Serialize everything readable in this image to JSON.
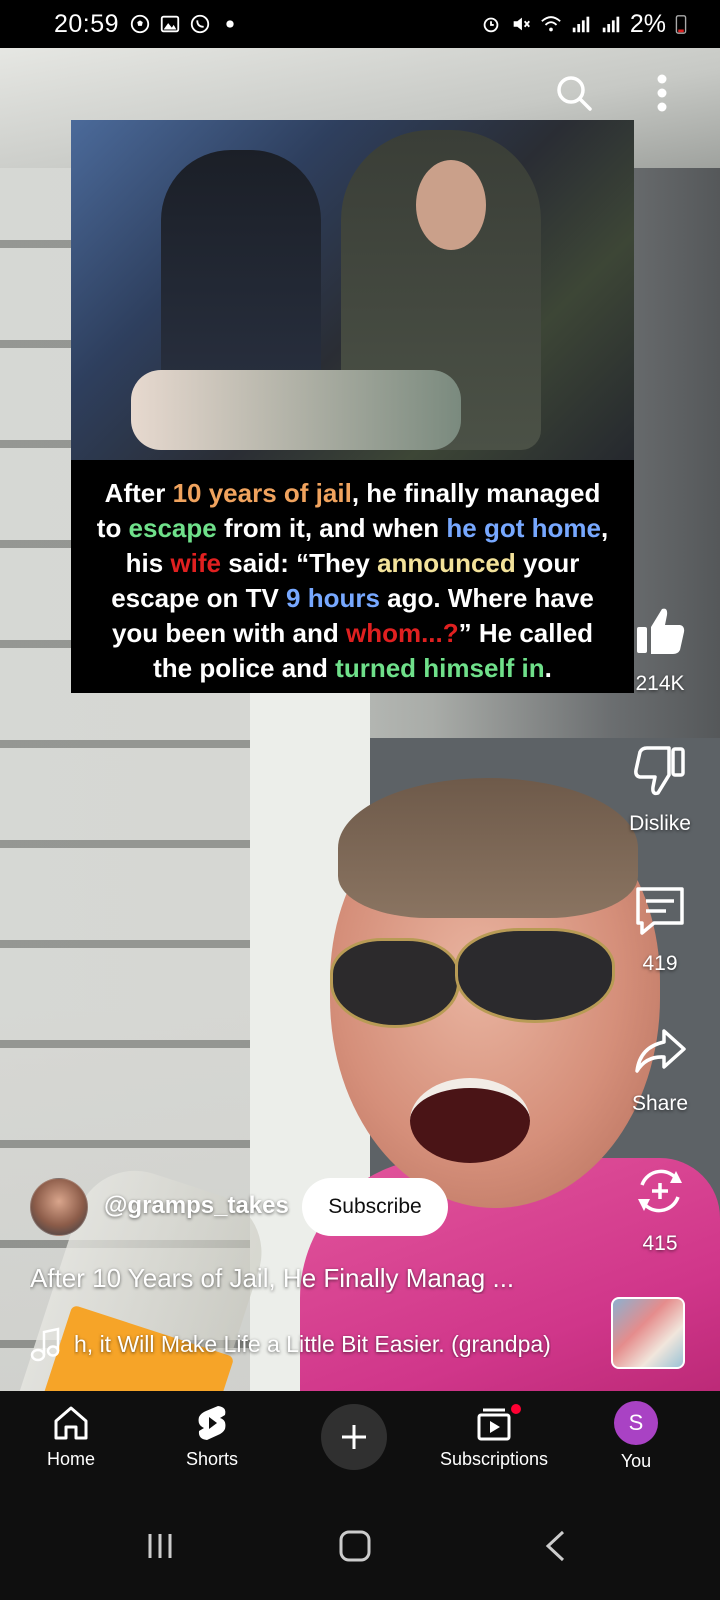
{
  "status_bar": {
    "time": "20:59",
    "battery": "2%",
    "left_icons": [
      "soccer-icon",
      "gallery-icon",
      "whatsapp-icon",
      "dot-icon"
    ],
    "right_icons": [
      "alarm-icon",
      "mute-icon",
      "wifi-icon",
      "signal-icon",
      "signal-icon",
      "battery-icon"
    ]
  },
  "overlay_caption": {
    "line1": [
      "After ",
      "10 years of jail",
      ", he finally managed"
    ],
    "line2": [
      "to ",
      "escape",
      " from it, and when ",
      "he got home",
      ","
    ],
    "line3": [
      "his ",
      "wife",
      " said: “They ",
      "announced",
      " your"
    ],
    "line4": [
      "escape on TV ",
      "9 hours",
      " ago. Where have"
    ],
    "line5": [
      "you been with and ",
      "whom...?",
      "” He called"
    ],
    "line6": [
      "the police and ",
      "turned himself in",
      "."
    ]
  },
  "actions": {
    "like_count": "214K",
    "dislike_label": "Dislike",
    "comment_count": "419",
    "share_label": "Share",
    "remix_count": "415"
  },
  "channel": {
    "handle": "@gramps_takes",
    "subscribe_label": "Subscribe"
  },
  "video": {
    "title": "After 10 Years of Jail, He Finally Manag ...",
    "music": "h, it Will Make Life a Little Bit Easier. (grandpa)"
  },
  "bottom_nav": {
    "home": "Home",
    "shorts": "Shorts",
    "subscriptions": "Subscriptions",
    "you": "You",
    "you_initial": "S"
  },
  "colors": {
    "accent_red": "#ff0033",
    "avatar_purple": "#a942c4",
    "nav_bg": "#0f0f0f"
  }
}
